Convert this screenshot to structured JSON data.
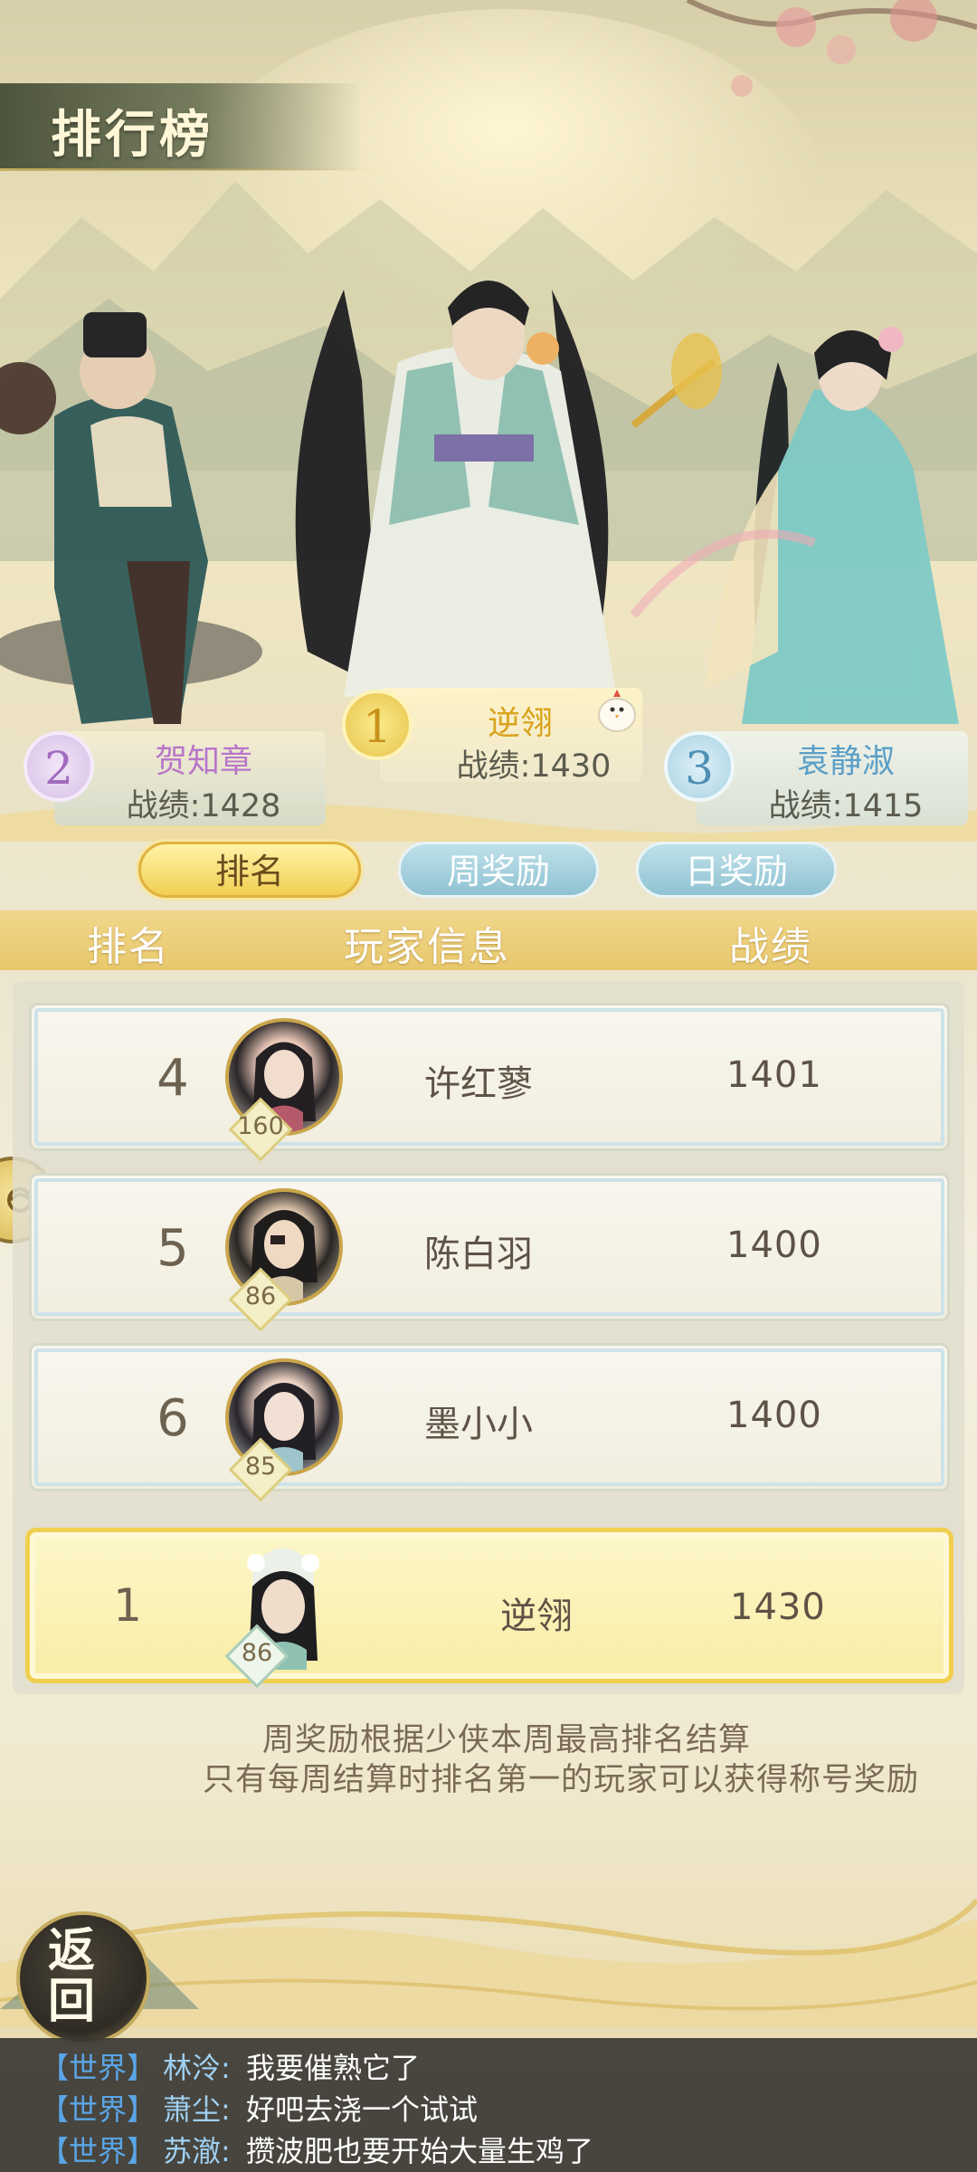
{
  "header": {
    "title": "排行榜"
  },
  "podium": [
    {
      "rank": "1",
      "name": "逆翎",
      "score_label": "战绩:1430",
      "name_color": "#d8a21a"
    },
    {
      "rank": "2",
      "name": "贺知章",
      "score_label": "战绩:1428",
      "name_color": "#b777c9"
    },
    {
      "rank": "3",
      "name": "袁静淑",
      "score_label": "战绩:1415",
      "name_color": "#5a9fc8"
    }
  ],
  "tabs": [
    {
      "label": "排名",
      "active": true
    },
    {
      "label": "周奖励",
      "active": false
    },
    {
      "label": "日奖励",
      "active": false
    }
  ],
  "table": {
    "columns": [
      "排名",
      "玩家信息",
      "战绩"
    ],
    "rows": [
      {
        "rank": "4",
        "name": "许红蓼",
        "score": "1401",
        "level": "160",
        "avatar_icon": "player-portrait-icon"
      },
      {
        "rank": "5",
        "name": "陈白羽",
        "score": "1400",
        "level": "86",
        "avatar_icon": "player-portrait-icon"
      },
      {
        "rank": "6",
        "name": "墨小小",
        "score": "1400",
        "level": "85",
        "avatar_icon": "player-portrait-icon"
      }
    ],
    "my_row": {
      "rank": "1",
      "name": "逆翎",
      "score": "1430",
      "level": "86"
    }
  },
  "notice": [
    "周奖励根据少侠本周最高排名结算",
    "只有每周结算时排名第一的玩家可以获得称号奖励"
  ],
  "back_button": {
    "label": "返回"
  },
  "chat": [
    {
      "channel": "【世界】",
      "user": "林泠:",
      "message": "我要催熟它了"
    },
    {
      "channel": "【世界】",
      "user": "萧尘:",
      "message": "好吧去浇一个试试"
    },
    {
      "channel": "【世界】",
      "user": "苏澈:",
      "message": "攒波肥也要开始大量生鸡了"
    }
  ],
  "colors": {
    "accent_gold": "#f0cf4f",
    "tab_blue": "#8fc2d2",
    "chat_channel": "#5aa5e6"
  }
}
